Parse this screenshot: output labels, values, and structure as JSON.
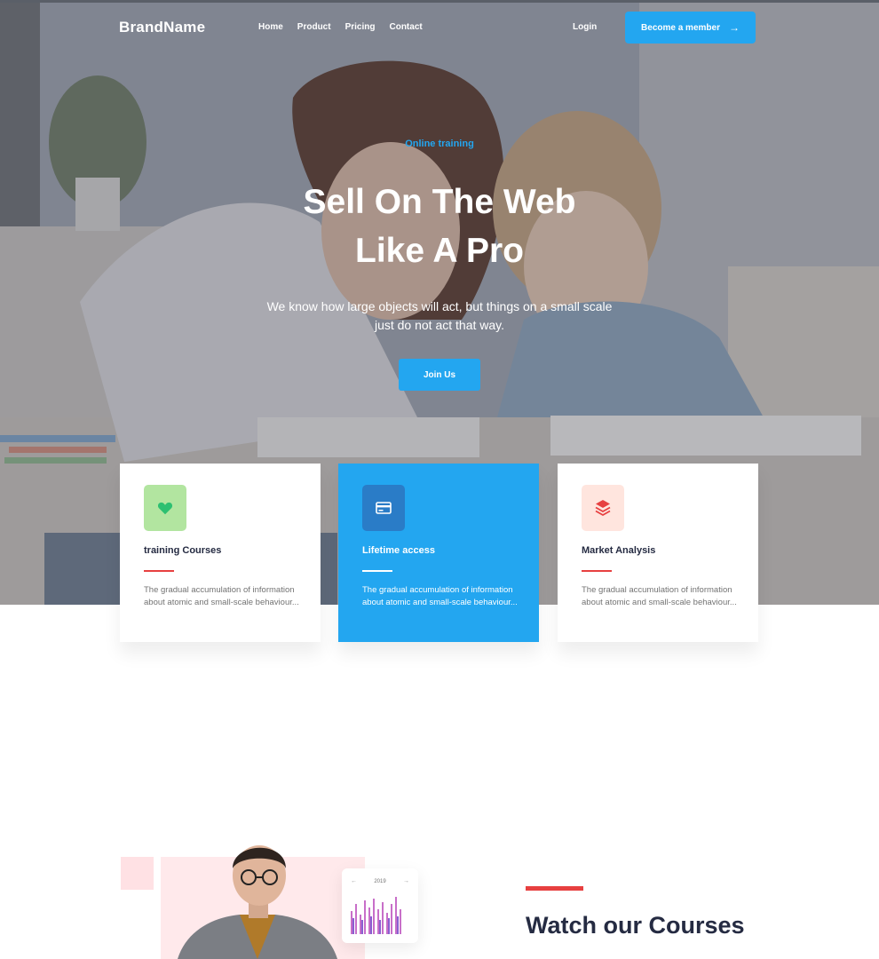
{
  "header": {
    "brand": "BrandName",
    "nav": [
      "Home",
      "Product",
      "Pricing",
      "Contact"
    ],
    "login": "Login",
    "member_button": "Become a member"
  },
  "hero": {
    "eyebrow": "Online training",
    "headline_line1": "Sell On The Web",
    "headline_line2": "Like A Pro",
    "subtitle": "We know how large objects will act, but things on a small scale just do not act that way.",
    "cta": "Join Us"
  },
  "features": [
    {
      "title": "training Courses",
      "description": "The gradual accumulation of information about atomic and small-scale behaviour...",
      "icon": "heart-icon",
      "icon_bg": "#B2E5A0",
      "icon_color": "#2DC071"
    },
    {
      "title": "Lifetime access",
      "description": "The gradual accumulation of information about atomic and small-scale behaviour...",
      "icon": "card-icon",
      "icon_bg": "#2A7CC7",
      "icon_color": "#ffffff"
    },
    {
      "title": "Market Analysis",
      "description": "The gradual accumulation of information about atomic and small-scale behaviour...",
      "icon": "layers-icon",
      "icon_bg": "#FFE5DE",
      "icon_color": "#E74040"
    }
  ],
  "watch": {
    "chart_year": "2019",
    "title": "Watch our Courses"
  },
  "colors": {
    "primary": "#23A6F0",
    "accent_red": "#E74040",
    "dark_text": "#252B42",
    "muted_text": "#737373"
  }
}
